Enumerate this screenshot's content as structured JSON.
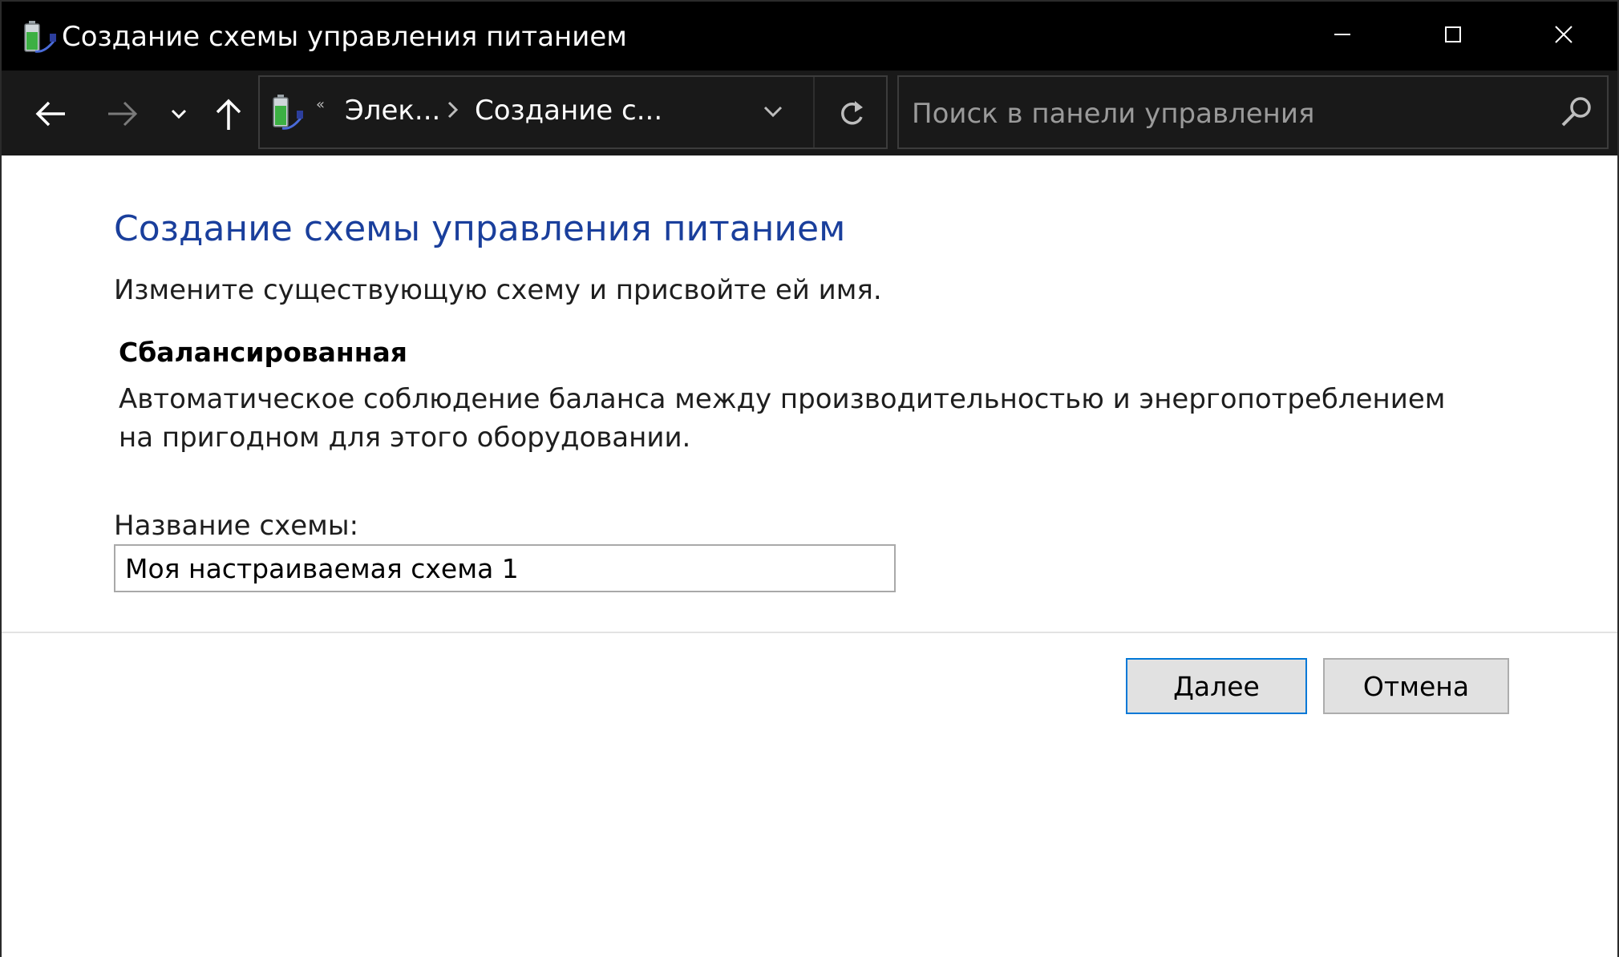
{
  "window": {
    "title": "Создание схемы управления питанием",
    "icon": "power-options-battery-icon",
    "controls": [
      "minimize-icon",
      "maximize-icon",
      "close-icon"
    ]
  },
  "navigation": {
    "breadcrumb_overflow": "«",
    "breadcrumbs": [
      "Элек...",
      "Создание с..."
    ],
    "search_placeholder": "Поиск в панели управления",
    "icons": [
      "arrow-left-icon",
      "arrow-right-icon",
      "chevron-down-icon",
      "arrow-up-icon",
      "refresh-icon",
      "search-icon"
    ]
  },
  "content": {
    "title": "Создание схемы управления питанием",
    "instruction": "Измените существующую схему и присвойте ей имя.",
    "plan": {
      "name": "Сбалансированная",
      "description": "Автоматическое соблюдение баланса между производительностью и энергопотреблением на пригодном для этого оборудовании."
    },
    "name_field": {
      "label": "Название схемы:",
      "value": "Моя настраиваемая схема 1"
    },
    "buttons": {
      "next": "Далее",
      "cancel": "Отмена"
    }
  },
  "colors": {
    "title_accent": "#1a3f9c",
    "titlebar_bg": "#000000",
    "navbar_bg": "#191919",
    "focus_border": "#0078d7"
  }
}
